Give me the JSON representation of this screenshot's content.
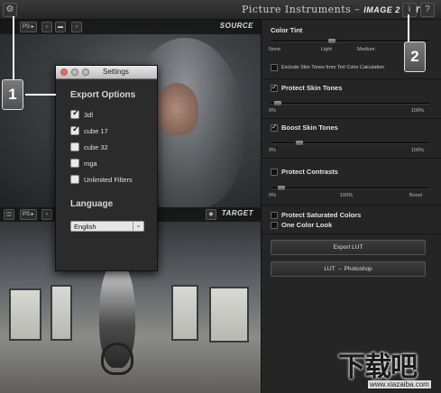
{
  "app": {
    "title_brand": "Picture Instruments",
    "title_product": "IMAGE 2 LUT",
    "info_label": "i",
    "help_label": "?",
    "gear_label": "⚙"
  },
  "source_bar": {
    "ps_label": "PS ▸",
    "label": "SOURCE"
  },
  "target_bar": {
    "ps_label": "PS ▸",
    "label": "TARGET"
  },
  "panel": {
    "color_tint": {
      "title": "Color Tint",
      "ticks": [
        "None",
        "Light",
        "Medium"
      ],
      "level": 0.38,
      "exclude_label": "Exclude Skin Tones from Tint Color Calculation",
      "exclude_checked": false
    },
    "protect_skin": {
      "title": "Protect Skin Tones",
      "checked": true,
      "ticks": [
        "0%",
        "100%"
      ],
      "level": 0.02
    },
    "boost_skin": {
      "title": "Boost Skin Tones",
      "checked": true,
      "ticks": [
        "0%",
        "100%"
      ],
      "level": 0.16
    },
    "protect_contrasts": {
      "title": "Protect Contrasts",
      "checked": false,
      "ticks": [
        "0%",
        "100%",
        "Boost"
      ],
      "level": 0.04
    },
    "protect_saturated": {
      "title": "Protect Saturated Colors",
      "checked": false
    },
    "one_color": {
      "title": "One Color Look",
      "checked": false
    },
    "export_button": "Export LUT",
    "photoshop_button": "LUT → Photoshop"
  },
  "settings_dialog": {
    "title": "Settings",
    "export_heading": "Export Options",
    "options": [
      {
        "label": "3dl",
        "checked": true
      },
      {
        "label": "cube 17",
        "checked": true
      },
      {
        "label": "cube 32",
        "checked": false
      },
      {
        "label": "mga",
        "checked": false
      },
      {
        "label": "Unlimited Filters",
        "checked": false
      }
    ],
    "language_heading": "Language",
    "language_value": "English"
  },
  "callouts": {
    "one": "1",
    "two": "2"
  },
  "watermark": {
    "glyphs": "下载吧",
    "url": "www.xiazaiba.com"
  },
  "colors": {
    "accent_red": "#ff5f57",
    "traffic_yellow": "#bcbcbc",
    "traffic_green": "#bcbcbc"
  }
}
